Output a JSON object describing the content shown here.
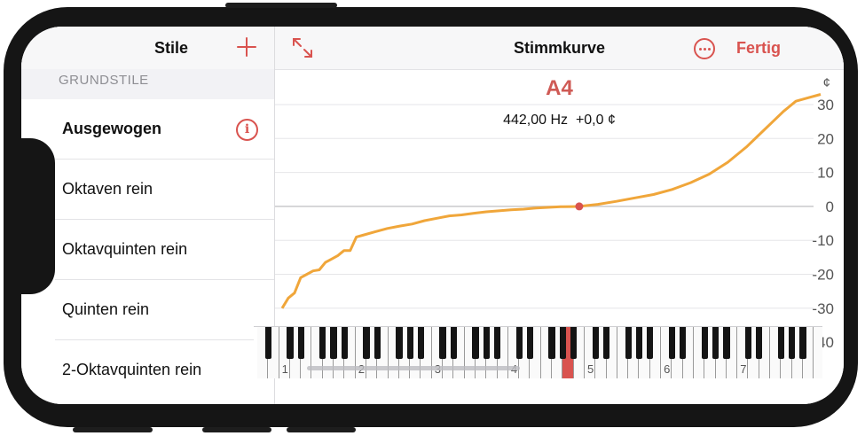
{
  "sidebar": {
    "title": "Stile",
    "section": "GRUNDSTILE",
    "items": [
      {
        "label": "Ausgewogen",
        "selected": true
      },
      {
        "label": "Oktaven rein"
      },
      {
        "label": "Oktavquinten rein"
      },
      {
        "label": "Quinten rein"
      },
      {
        "label": "2-Oktavquinten rein"
      }
    ]
  },
  "header": {
    "title": "Stimmkurve",
    "done_label": "Fertig"
  },
  "note": {
    "name": "A4",
    "frequency": "442,00 Hz",
    "offset": "+0,0 ¢"
  },
  "keyboard": {
    "octave_labels": [
      "1",
      "2",
      "3",
      "4",
      "5",
      "6",
      "7"
    ],
    "highlight_key": "A4"
  },
  "colors": {
    "accent": "#d9534f",
    "curve": "#f0a63a"
  },
  "chart_data": {
    "type": "line",
    "y_unit": "¢",
    "yticks": [
      "30",
      "20",
      "10",
      "0",
      "-10",
      "-20",
      "-30",
      "-40"
    ],
    "ylim": [
      -40,
      30
    ],
    "x_key_range": [
      1,
      88
    ],
    "marker": {
      "key": 49,
      "value": 0
    },
    "series": [
      {
        "x": [
          1,
          2,
          3,
          4,
          5,
          6,
          7,
          8,
          9,
          10,
          11,
          12,
          13,
          14,
          16,
          18,
          20,
          22,
          24,
          26,
          28,
          30,
          32,
          34,
          36,
          38,
          40,
          42,
          44,
          46,
          48,
          49,
          52,
          55,
          58,
          61,
          64,
          67,
          70,
          73,
          76,
          78,
          80,
          82,
          84,
          86,
          88
        ],
        "values": [
          -30,
          -27,
          -25.5,
          -21,
          -20,
          -19,
          -18.7,
          -16.5,
          -15.5,
          -14.5,
          -13,
          -13,
          -9,
          -8.5,
          -7.5,
          -6.5,
          -5.8,
          -5.2,
          -4.2,
          -3.5,
          -2.8,
          -2.5,
          -2,
          -1.6,
          -1.3,
          -1,
          -0.8,
          -0.5,
          -0.3,
          -0.1,
          -0.05,
          0,
          0.6,
          1.5,
          2.5,
          3.5,
          5,
          7,
          9.5,
          13,
          17.5,
          21,
          24.5,
          28,
          31,
          32,
          33
        ]
      }
    ]
  }
}
